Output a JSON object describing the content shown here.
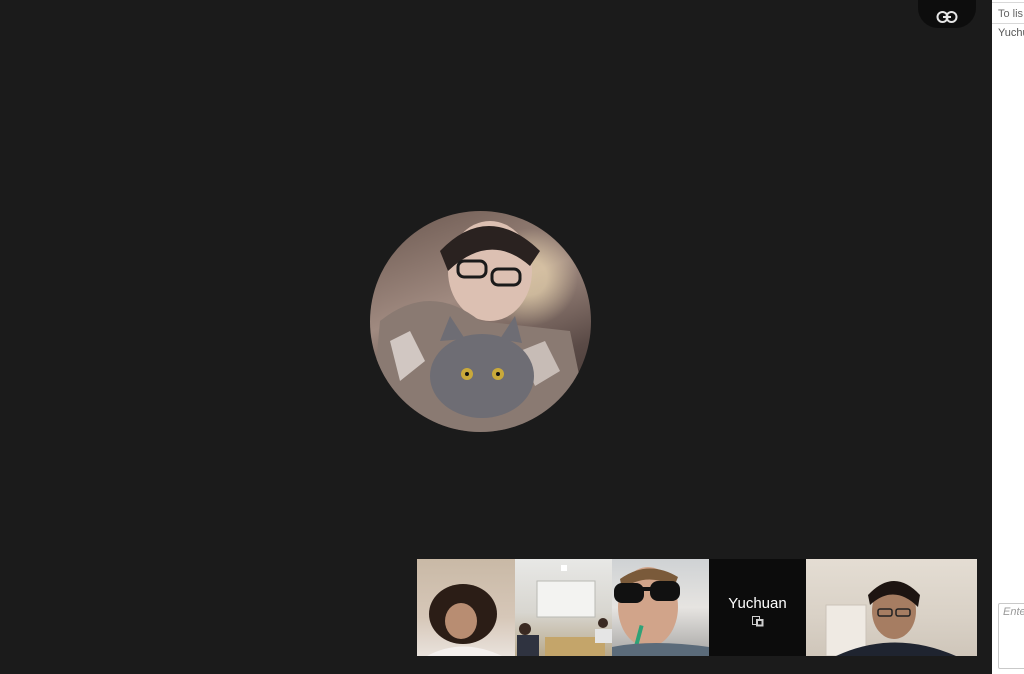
{
  "toolbar": {
    "link_icon": "link-icon"
  },
  "main": {
    "speaker_avatar_alt": ""
  },
  "participants": [
    {
      "type": "video"
    },
    {
      "type": "video"
    },
    {
      "type": "video"
    },
    {
      "type": "label",
      "name": "Yuchuan",
      "icon": "screen-share-icon"
    },
    {
      "type": "video"
    }
  ],
  "chat": {
    "to_label": "To lis",
    "message_author": "Yuchu",
    "input_placeholder": "Ente"
  }
}
